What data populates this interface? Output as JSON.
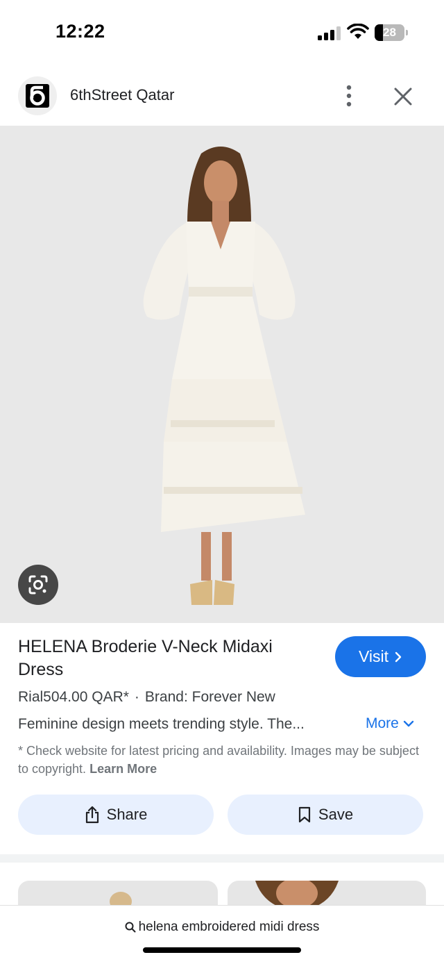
{
  "status_bar": {
    "time": "12:22",
    "battery_level": "28"
  },
  "site": {
    "name": "6thStreet Qatar",
    "logo_icon": "6thstreet-logo-icon"
  },
  "product": {
    "title": "HELENA Broderie V-Neck Midaxi Dress",
    "price": "Rial504.00 QAR*",
    "separator": "·",
    "brand": "Brand: Forever New",
    "description": "Feminine design meets trending style. The...",
    "more_label": "More",
    "disclaimer": "* Check website for latest pricing and availability. Images may be subject to copyright.",
    "learn_more_label": "Learn More"
  },
  "actions": {
    "visit_label": "Visit",
    "share_label": "Share",
    "save_label": "Save"
  },
  "search": {
    "query": "helena embroidered midi dress"
  },
  "colors": {
    "accent": "#1a73e8",
    "button_bg": "#e8f0fe",
    "image_bg": "#e8e8e8"
  }
}
